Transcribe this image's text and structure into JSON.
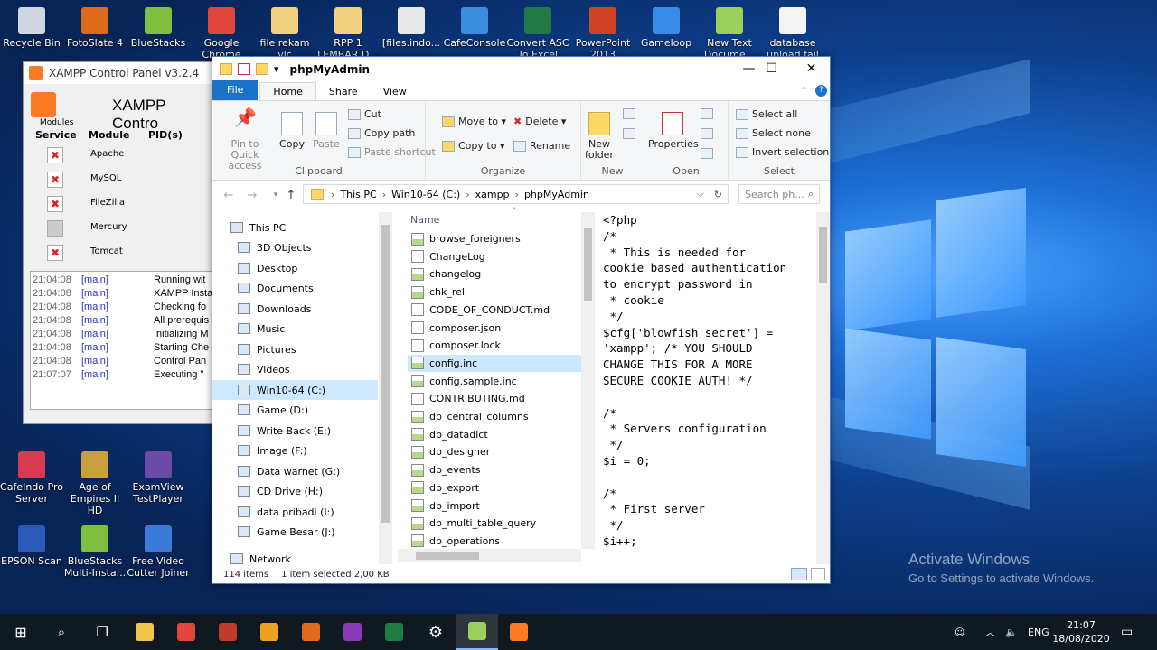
{
  "desktop": {
    "icons": [
      {
        "label": "Recycle Bin",
        "icon": "recycle-bin-icon",
        "color": "#cfd8e0"
      },
      {
        "label": "FotoSlate 4",
        "icon": "fotoslate-icon",
        "color": "#e06a1c"
      },
      {
        "label": "BlueStacks",
        "icon": "bluestacks-icon",
        "color": "#7fbf3f"
      },
      {
        "label": "Google Chrome",
        "icon": "chrome-icon",
        "color": "#e0463b"
      },
      {
        "label": "file rekam vlc",
        "icon": "folder-icon",
        "color": "#f1d080"
      },
      {
        "label": "RPP 1 LEMBAR D...",
        "icon": "folder-icon",
        "color": "#f1d080"
      },
      {
        "label": "[files.indo...",
        "icon": "document-icon",
        "color": "#e8e8e8"
      },
      {
        "label": "CafeConsole",
        "icon": "cafeconsole-icon",
        "color": "#3b8de0"
      },
      {
        "label": "Convert ASC To Excel Free",
        "icon": "excel-icon",
        "color": "#1f7a44"
      },
      {
        "label": "PowerPoint 2013",
        "icon": "powerpoint-icon",
        "color": "#d04423"
      },
      {
        "label": "Gameloop",
        "icon": "gameloop-icon",
        "color": "#3a8ae8"
      },
      {
        "label": "New Text Docume...",
        "icon": "text-document-icon",
        "color": "#9ccf5c"
      },
      {
        "label": "database upload fail fix",
        "icon": "document-icon",
        "color": "#f4f4f4"
      }
    ],
    "left_icons": [
      {
        "label": "CafeIndo Pro Server",
        "icon": "cafeindo-icon",
        "color": "#d83a52"
      },
      {
        "label": "Age of Empires II HD",
        "icon": "age-of-empires-icon",
        "color": "#c9a03b"
      },
      {
        "label": "ExamView TestPlayer",
        "icon": "examview-icon",
        "color": "#6b4aa8"
      },
      {
        "label": "EPSON Scan",
        "icon": "epson-scan-icon",
        "color": "#2a5bb8"
      },
      {
        "label": "BlueStacks Multi-Insta...",
        "icon": "bluestacks-icon",
        "color": "#7fbf3f"
      },
      {
        "label": "Free Video Cutter Joiner",
        "icon": "video-cutter-icon",
        "color": "#3a7ad8"
      }
    ],
    "watermark": {
      "line1": "Activate Windows",
      "line2": "Go to Settings to activate Windows."
    }
  },
  "xampp": {
    "title": "XAMPP Control Panel v3.2.4",
    "heading": "XAMPP Contro",
    "modules_label": "Modules",
    "columns": [
      "Service",
      "Module",
      "PID(s)"
    ],
    "services": [
      {
        "module": "Apache",
        "state": "x"
      },
      {
        "module": "MySQL",
        "state": "x"
      },
      {
        "module": "FileZilla",
        "state": "x"
      },
      {
        "module": "Mercury",
        "state": "gray"
      },
      {
        "module": "Tomcat",
        "state": "x"
      }
    ],
    "log": [
      {
        "time": "21:04:08",
        "tag": "[main]",
        "msg": "Running wit"
      },
      {
        "time": "21:04:08",
        "tag": "[main]",
        "msg": "XAMPP Insta"
      },
      {
        "time": "21:04:08",
        "tag": "[main]",
        "msg": "Checking fo"
      },
      {
        "time": "21:04:08",
        "tag": "[main]",
        "msg": "All prerequis"
      },
      {
        "time": "21:04:08",
        "tag": "[main]",
        "msg": "Initializing M"
      },
      {
        "time": "21:04:08",
        "tag": "[main]",
        "msg": "Starting Che"
      },
      {
        "time": "21:04:08",
        "tag": "[main]",
        "msg": "Control Pan"
      },
      {
        "time": "21:07:07",
        "tag": "[main]",
        "msg": "Executing \""
      }
    ]
  },
  "explorer": {
    "title": "phpMyAdmin",
    "tabs": [
      "File",
      "Home",
      "Share",
      "View"
    ],
    "ribbon": {
      "clipboard": {
        "pin": "Pin to Quick access",
        "copy": "Copy",
        "paste": "Paste",
        "cut": "Cut",
        "copy_path": "Copy path",
        "paste_shortcut": "Paste shortcut",
        "label": "Clipboard"
      },
      "organize": {
        "move_to": "Move to ▾",
        "copy_to": "Copy to ▾",
        "delete": "Delete ▾",
        "rename": "Rename",
        "label": "Organize"
      },
      "new": {
        "new_folder": "New folder",
        "label": "New"
      },
      "open": {
        "properties": "Properties",
        "label": "Open"
      },
      "select": {
        "select_all": "Select all",
        "select_none": "Select none",
        "invert": "Invert selection",
        "label": "Select"
      }
    },
    "address": [
      "This PC",
      "Win10-64 (C:)",
      "xampp",
      "phpMyAdmin"
    ],
    "search_placeholder": "Search ph...",
    "tree": [
      {
        "label": "This PC",
        "icon": "computer-icon"
      },
      {
        "label": "3D Objects",
        "icon": "3d-objects-icon"
      },
      {
        "label": "Desktop",
        "icon": "desktop-folder-icon"
      },
      {
        "label": "Documents",
        "icon": "documents-icon"
      },
      {
        "label": "Downloads",
        "icon": "downloads-icon"
      },
      {
        "label": "Music",
        "icon": "music-icon"
      },
      {
        "label": "Pictures",
        "icon": "pictures-icon"
      },
      {
        "label": "Videos",
        "icon": "videos-icon"
      },
      {
        "label": "Win10-64 (C:)",
        "icon": "drive-icon",
        "selected": true
      },
      {
        "label": "Game (D:)",
        "icon": "drive-icon"
      },
      {
        "label": "Write Back (E:)",
        "icon": "drive-icon"
      },
      {
        "label": "Image (F:)",
        "icon": "drive-icon"
      },
      {
        "label": "Data warnet (G:)",
        "icon": "drive-icon"
      },
      {
        "label": "CD Drive (H:)",
        "icon": "cd-drive-icon"
      },
      {
        "label": "data pribadi (I:)",
        "icon": "drive-icon"
      },
      {
        "label": "Game Besar (J:)",
        "icon": "drive-icon"
      },
      {
        "label": "Network",
        "icon": "network-icon"
      }
    ],
    "files_header": "Name",
    "files": [
      {
        "name": "browse_foreigners",
        "kind": "inc"
      },
      {
        "name": "ChangeLog",
        "kind": "plain"
      },
      {
        "name": "changelog",
        "kind": "inc"
      },
      {
        "name": "chk_rel",
        "kind": "inc"
      },
      {
        "name": "CODE_OF_CONDUCT.md",
        "kind": "plain"
      },
      {
        "name": "composer.json",
        "kind": "plain"
      },
      {
        "name": "composer.lock",
        "kind": "plain"
      },
      {
        "name": "config.inc",
        "kind": "inc",
        "selected": true
      },
      {
        "name": "config.sample.inc",
        "kind": "inc"
      },
      {
        "name": "CONTRIBUTING.md",
        "kind": "plain"
      },
      {
        "name": "db_central_columns",
        "kind": "inc"
      },
      {
        "name": "db_datadict",
        "kind": "inc"
      },
      {
        "name": "db_designer",
        "kind": "inc"
      },
      {
        "name": "db_events",
        "kind": "inc"
      },
      {
        "name": "db_export",
        "kind": "inc"
      },
      {
        "name": "db_import",
        "kind": "inc"
      },
      {
        "name": "db_multi_table_query",
        "kind": "inc"
      },
      {
        "name": "db_operations",
        "kind": "inc"
      }
    ],
    "preview": "<?php\n/*\n * This is needed for\ncookie based authentication\nto encrypt password in\n * cookie\n */\n$cfg['blowfish_secret'] =\n'xampp'; /* YOU SHOULD\nCHANGE THIS FOR A MORE\nSECURE COOKIE AUTH! */\n\n/*\n * Servers configuration\n */\n$i = 0;\n\n/*\n * First server\n */\n$i++;",
    "status": {
      "count": "114 items",
      "selection": "1 item selected  2,00 KB"
    }
  },
  "taskbar": {
    "apps": [
      {
        "name": "start-button",
        "icon": "windows-icon",
        "color": "#ffffff"
      },
      {
        "name": "search-button",
        "icon": "search-icon",
        "color": "#ffffff"
      },
      {
        "name": "task-view-button",
        "icon": "task-view-icon",
        "color": "#ffffff"
      },
      {
        "name": "file-explorer-task",
        "icon": "folder-icon",
        "color": "#f1c54a"
      },
      {
        "name": "chrome-task",
        "icon": "chrome-icon",
        "color": "#e0463b"
      },
      {
        "name": "app-task",
        "icon": "app-icon",
        "color": "#c0392b"
      },
      {
        "name": "search-app-task",
        "icon": "magnifier-icon",
        "color": "#f0a020"
      },
      {
        "name": "fotoslate-task",
        "icon": "fotoslate-icon",
        "color": "#e06a1c"
      },
      {
        "name": "pdf-task",
        "icon": "pdf-icon",
        "color": "#8a3ab8"
      },
      {
        "name": "excel-task",
        "icon": "excel-icon",
        "color": "#1f7a44"
      },
      {
        "name": "settings-task",
        "icon": "gear-icon",
        "color": "#ffffff"
      },
      {
        "name": "notepad-task",
        "icon": "notepad-icon",
        "color": "#9ccf5c"
      },
      {
        "name": "xampp-task",
        "icon": "xampp-icon",
        "color": "#fb7a24"
      }
    ],
    "lang": "ENG",
    "time": "21:07",
    "date": "18/08/2020"
  }
}
